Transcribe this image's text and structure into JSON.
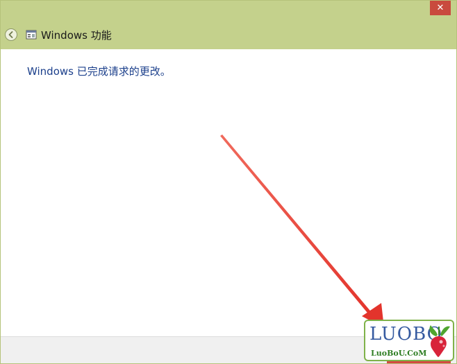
{
  "window": {
    "title": "Windows 功能",
    "close_glyph": "✕",
    "message": "Windows 已完成请求的更改。"
  },
  "watermark": {
    "logo_text": "LUOBO",
    "url_text": "LuoBoU.CoM"
  },
  "colors": {
    "titlebar": "#c4d18c",
    "message_text": "#1b3f8b",
    "close_button": "#c94a3e",
    "annotation_arrow": "#e8403a"
  },
  "icons": {
    "back": "back-arrow-icon",
    "app": "windows-features-icon",
    "close": "close-icon"
  }
}
